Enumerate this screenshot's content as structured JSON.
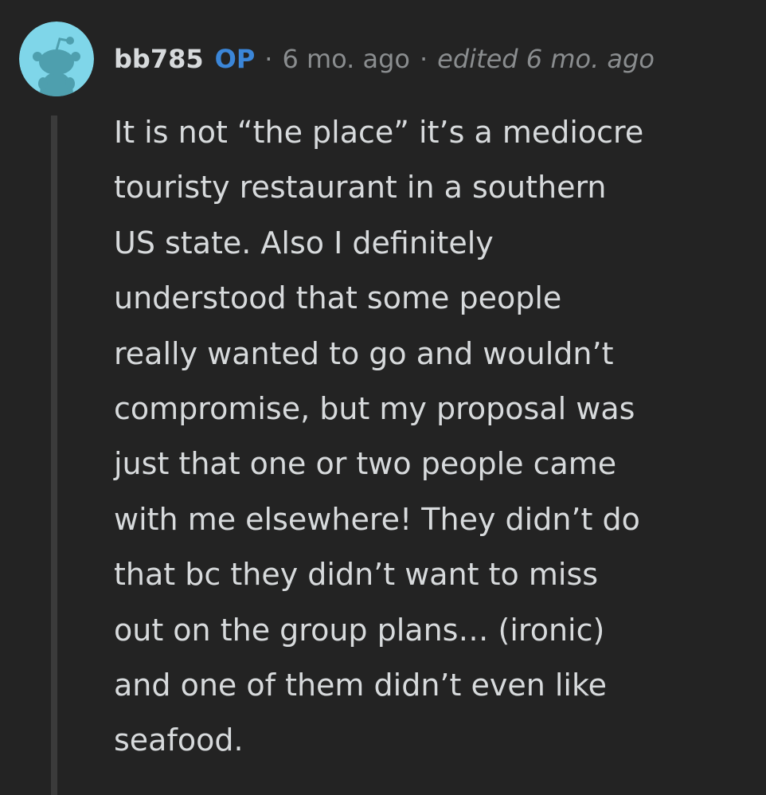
{
  "comment": {
    "author": "bb785",
    "op_badge": "OP",
    "separator": "·",
    "posted_time": "6 mo. ago",
    "edited_label": "edited 6 mo. ago",
    "body_lines": [
      "It is not “the place” it’s a mediocre",
      "touristy restaurant in a southern",
      "US state. Also I definitely",
      "understood that some people",
      "really wanted to go and wouldn’t",
      "compromise, but my proposal was",
      "just that one or two people came",
      "with me elsewhere! They didn’t do",
      "that bc they didn’t want to miss",
      "out on the group plans… (ironic)",
      "and one of them didn’t even like",
      "seafood."
    ]
  },
  "avatar": {
    "icon": "snoo-avatar-icon",
    "background_color": "#7fd6e9",
    "figure_color": "#4e9fae"
  },
  "colors": {
    "background": "#232323",
    "text": "#d7dadc",
    "muted": "#8a8d8f",
    "op_accent": "#3b86d8",
    "thread_line": "#3b3b3b"
  }
}
